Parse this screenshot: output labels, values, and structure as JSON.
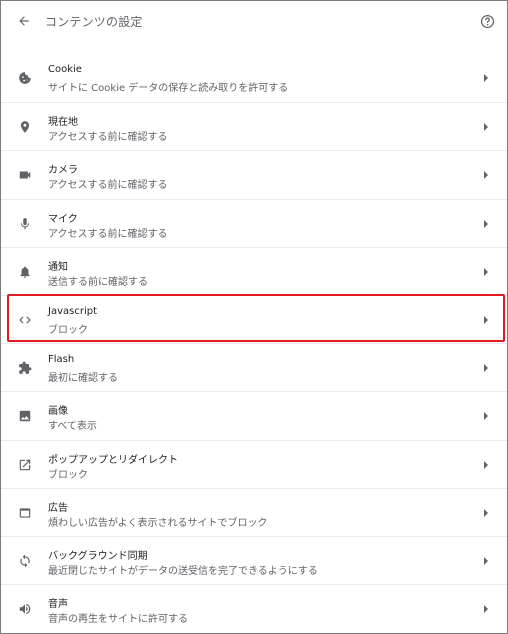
{
  "header": {
    "title": "コンテンツの設定",
    "back_icon": "arrow-back-icon",
    "help_icon": "help-circle-icon"
  },
  "rows": [
    {
      "label": "Cookie",
      "sub": "サイトに Cookie データの保存と読み取りを許可する",
      "icon": "cookie-icon"
    },
    {
      "label": "現在地",
      "sub": "アクセスする前に確認する",
      "icon": "location-pin-icon"
    },
    {
      "label": "カメラ",
      "sub": "アクセスする前に確認する",
      "icon": "camera-icon"
    },
    {
      "label": "マイク",
      "sub": "アクセスする前に確認する",
      "icon": "microphone-icon"
    },
    {
      "label": "通知",
      "sub": "送信する前に確認する",
      "icon": "bell-icon"
    },
    {
      "label": "Javascript",
      "sub": "ブロック",
      "icon": "code-icon"
    },
    {
      "label": "Flash",
      "sub": "最初に確認する",
      "icon": "puzzle-icon"
    },
    {
      "label": "画像",
      "sub": "すべて表示",
      "icon": "image-icon"
    },
    {
      "label": "ポップアップとリダイレクト",
      "sub": "ブロック",
      "icon": "open-in-new-icon"
    },
    {
      "label": "広告",
      "sub": "煩わしい広告がよく表示されるサイトでブロック",
      "icon": "ad-window-icon"
    },
    {
      "label": "バックグラウンド同期",
      "sub": "最近閉じたサイトがデータの送受信を完了できるようにする",
      "icon": "sync-icon"
    },
    {
      "label": "音声",
      "sub": "音声の再生をサイトに許可する",
      "icon": "volume-icon"
    }
  ],
  "colors": {
    "highlight": "#e01b24",
    "icon": "#5f6368",
    "divider": "#e8eaed"
  }
}
